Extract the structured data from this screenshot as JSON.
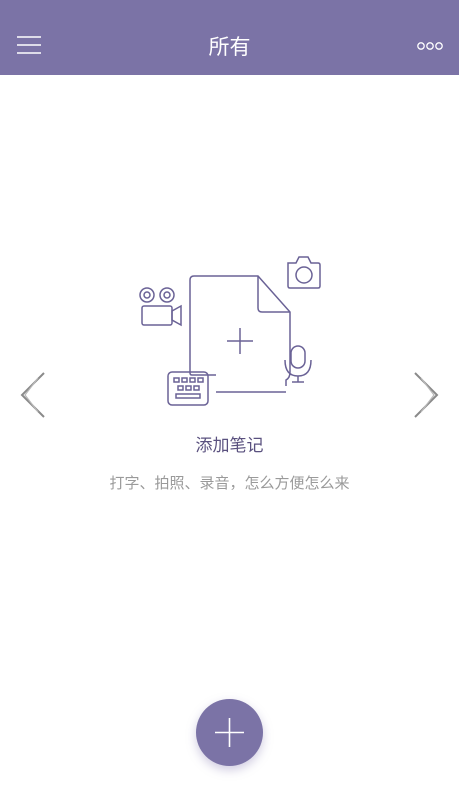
{
  "header": {
    "title": "所有",
    "menu_icon": "hamburger-menu-icon",
    "more_icon": "more-dots-icon"
  },
  "empty_state": {
    "title": "添加笔记",
    "subtitle": "打字、拍照、录音，怎么方便怎么来",
    "icons": [
      "video-camera-icon",
      "document-add-icon",
      "camera-icon",
      "microphone-icon",
      "keyboard-icon"
    ]
  },
  "navigation": {
    "prev_icon": "chevron-left-icon",
    "next_icon": "chevron-right-icon"
  },
  "fab": {
    "icon": "plus-icon"
  },
  "colors": {
    "primary": "#7b73a6",
    "illustration_stroke": "#6a6296",
    "title_text": "#5a517f",
    "subtitle_text": "#9a9a9a",
    "arrow_stroke": "#8a8a8a",
    "background": "#ffffff"
  }
}
